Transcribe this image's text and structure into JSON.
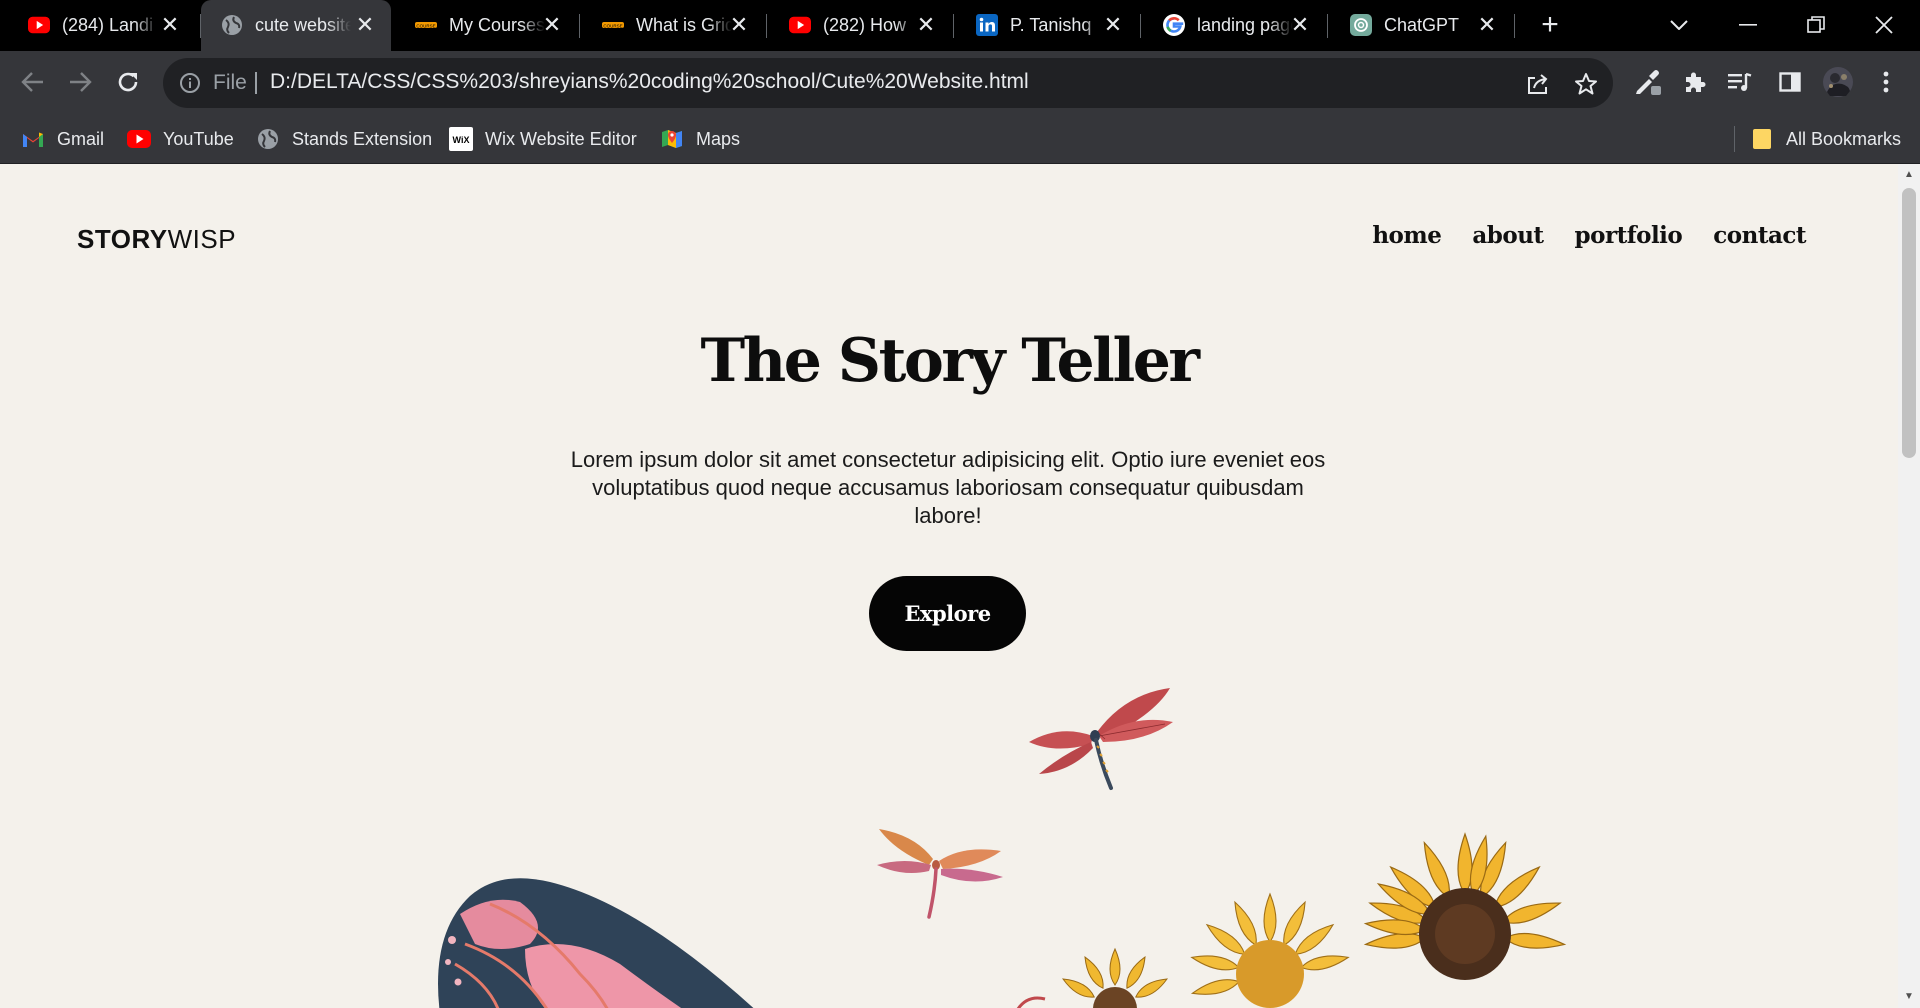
{
  "browser": {
    "tabs": [
      {
        "title": "(284) Landi",
        "icon": "youtube-icon",
        "active": false
      },
      {
        "title": "cute website",
        "icon": "globe-icon",
        "active": true
      },
      {
        "title": "My Courses",
        "icon": "course-icon",
        "active": false
      },
      {
        "title": "What is Grid",
        "icon": "course-icon",
        "active": false
      },
      {
        "title": "(282) How",
        "icon": "youtube-icon",
        "active": false
      },
      {
        "title": "P. Tanishq",
        "icon": "linkedin-icon",
        "active": false
      },
      {
        "title": "landing page",
        "icon": "google-icon",
        "active": false
      },
      {
        "title": "ChatGPT",
        "icon": "chatgpt-icon",
        "active": false
      }
    ],
    "new_tab": "+",
    "address": {
      "scheme": "File",
      "url": "D:/DELTA/CSS/CSS%203/shreyians%20coding%20school/Cute%20Website.html"
    },
    "bookmarks": [
      {
        "label": "Gmail",
        "icon": "gmail-icon"
      },
      {
        "label": "YouTube",
        "icon": "youtube-icon"
      },
      {
        "label": "Stands Extension",
        "icon": "stands-icon"
      },
      {
        "label": "Wix Website Editor",
        "icon": "wix-icon"
      },
      {
        "label": "Maps",
        "icon": "maps-icon"
      }
    ],
    "all_bookmarks": "All Bookmarks",
    "colors": {
      "youtube": "#ff0000",
      "linkedin": "#0a66c2",
      "bookmark_folder": "#fdd663"
    }
  },
  "page": {
    "logo": {
      "bold": "STORY",
      "light": "WISP"
    },
    "nav": [
      "home",
      "about",
      "portfolio",
      "contact"
    ],
    "hero": {
      "title": "The Story Teller",
      "text": "Lorem ipsum dolor sit amet consectetur adipisicing elit. Optio iure eveniet eos voluptatibus quod neque accusamus laboriosam consequatur quibusdam labore!",
      "button": "Explore"
    },
    "colors": {
      "background": "#f4f1eb",
      "button": "#050505",
      "text": "#0d0d0d"
    },
    "illustrations": [
      "dragonfly-red",
      "dragonfly-orange",
      "butterfly-wing",
      "sunflowers"
    ]
  }
}
